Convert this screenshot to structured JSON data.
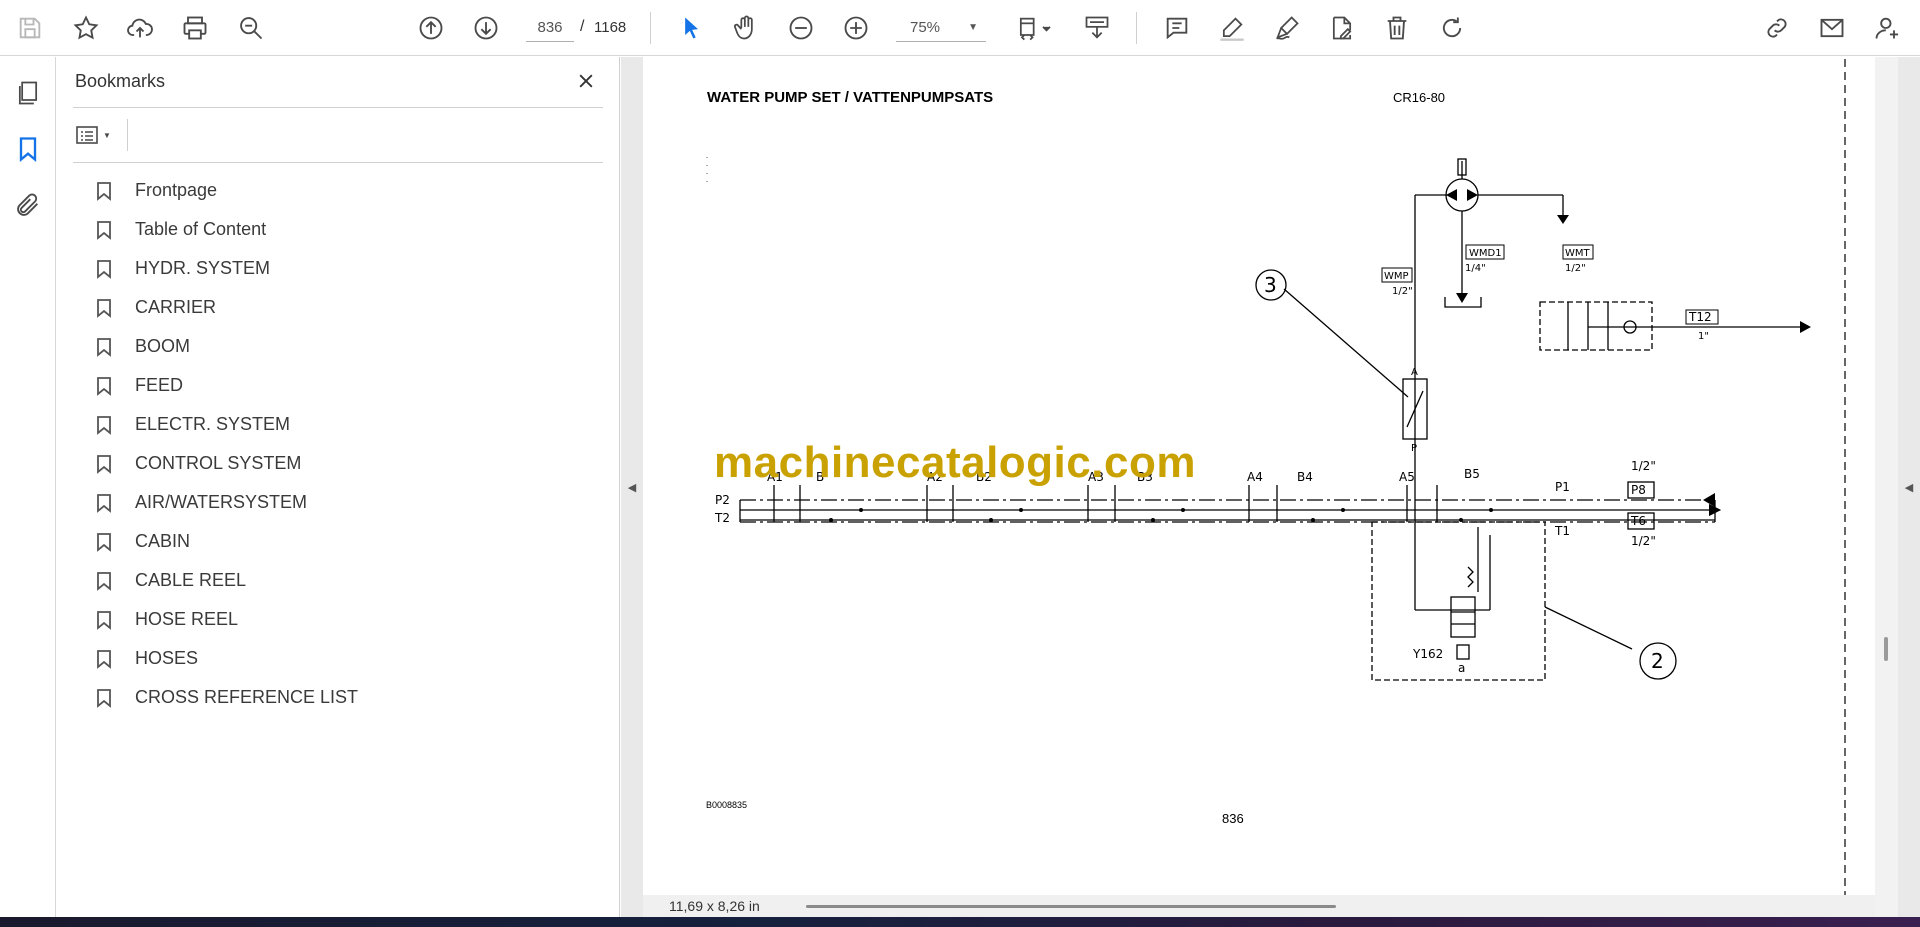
{
  "toolbar": {
    "current_page": "836",
    "page_separator": "/",
    "total_pages": "1168",
    "zoom": "75%"
  },
  "bookmarks_panel": {
    "title": "Bookmarks",
    "items": [
      {
        "label": "Frontpage"
      },
      {
        "label": "Table of Content"
      },
      {
        "label": "HYDR. SYSTEM"
      },
      {
        "label": "CARRIER"
      },
      {
        "label": "BOOM"
      },
      {
        "label": "FEED"
      },
      {
        "label": "ELECTR. SYSTEM"
      },
      {
        "label": "CONTROL SYSTEM"
      },
      {
        "label": "AIR/WATERSYSTEM"
      },
      {
        "label": "CABIN"
      },
      {
        "label": "CABLE REEL"
      },
      {
        "label": "HOSE REEL"
      },
      {
        "label": "HOSES"
      },
      {
        "label": "CROSS REFERENCE LIST"
      }
    ]
  },
  "document": {
    "title": "WATER PUMP SET / VATTENPUMPSATS",
    "code": "CR16-80",
    "drawing_id": "B0008835",
    "page_number": "836",
    "watermark": "machinecatalogic.com",
    "diagram_labels": {
      "wmp": "WMP",
      "wmp_size": "1/2\"",
      "wmd1": "WMD1",
      "wmd1_size": "1/4\"",
      "wmt": "WMT",
      "wmt_size": "1/2\"",
      "t12": "T12",
      "t12_size": "1\"",
      "callout_3": "3",
      "callout_2": "2",
      "port_a": "A",
      "port_p": "P",
      "p2": "P2",
      "t2": "T2",
      "p1": "P1",
      "t1": "T1",
      "a1": "A1",
      "b": "B",
      "a2": "A2",
      "b2": "B2",
      "a3": "A3",
      "b3": "B3",
      "a4": "A4",
      "b4": "B4",
      "a5": "A5",
      "b5": "B5",
      "p8": "P8",
      "p8_size": "1/2\"",
      "t6": "T6",
      "t6_size": "1/2\"",
      "y162": "Y162",
      "solenoid_a": "a"
    }
  },
  "status_bar": {
    "page_size": "11,69 x 8,26 in"
  },
  "icons": {
    "toolbar_left": [
      "save-icon",
      "star-icon",
      "upload-cloud-icon",
      "print-icon",
      "search-zoom-icon"
    ],
    "navigation": [
      "page-up-icon",
      "page-down-icon"
    ],
    "zoom": [
      "zoom-out-icon",
      "zoom-in-icon"
    ],
    "tools": [
      "select-cursor-icon",
      "hand-icon",
      "fit-page-icon",
      "scroll-mode-icon",
      "comment-icon",
      "highlight-icon",
      "sign-icon",
      "edit-pdf-icon",
      "delete-icon",
      "rotate-icon",
      "share-link-icon",
      "mail-icon",
      "account-icon"
    ],
    "accent_color": "#1473e6"
  }
}
